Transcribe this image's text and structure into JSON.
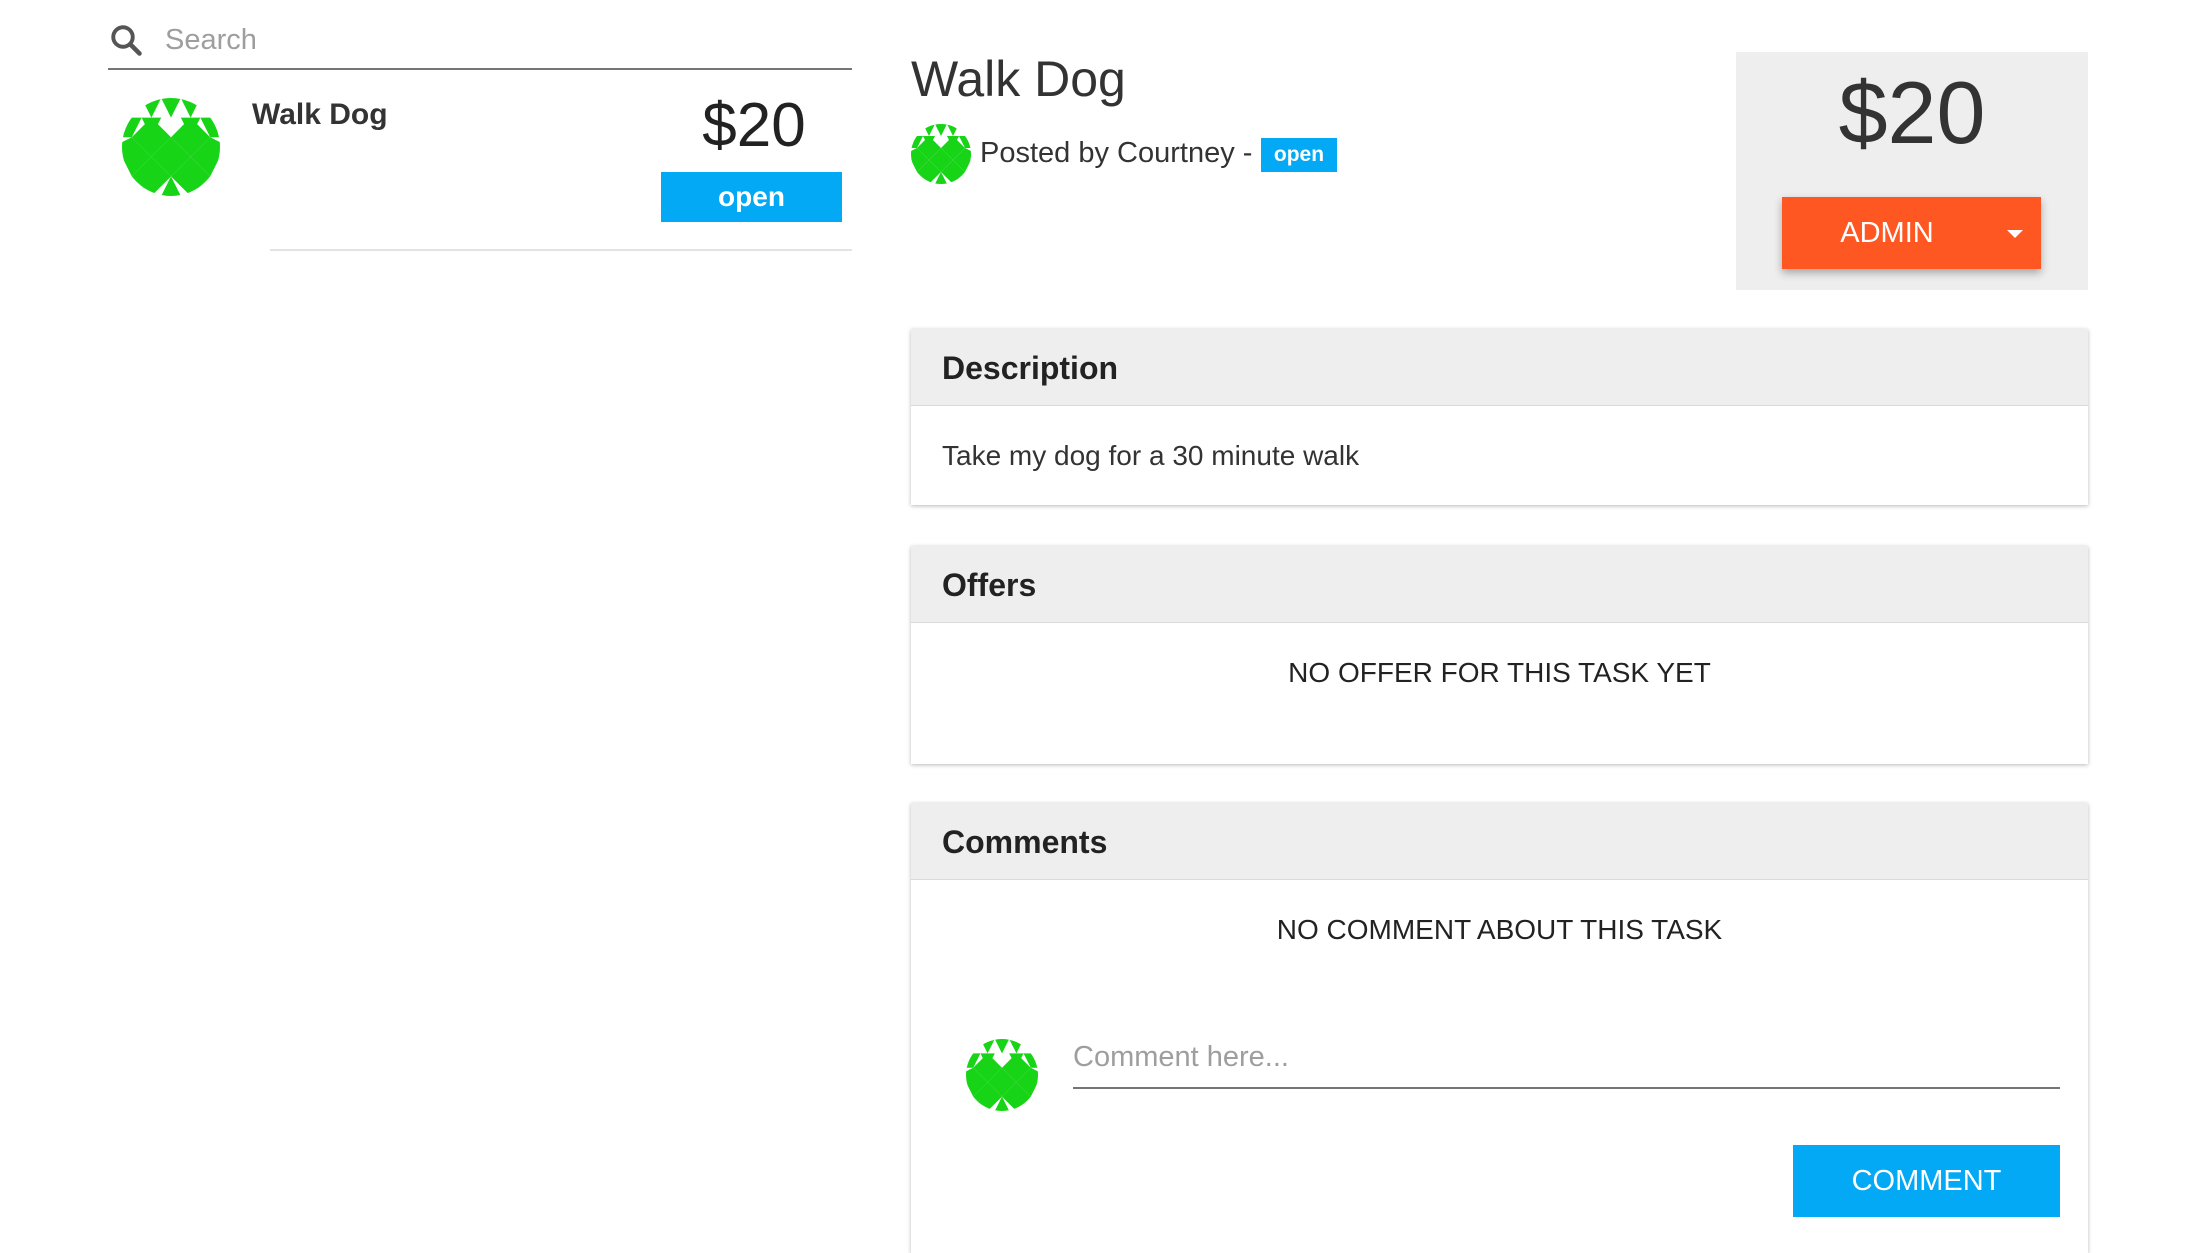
{
  "search": {
    "placeholder": "Search",
    "icon": "search-icon"
  },
  "task_list": [
    {
      "title": "Walk Dog",
      "price": "$20",
      "status": "open"
    }
  ],
  "detail": {
    "title": "Walk Dog",
    "posted_by": "Posted by Courtney -",
    "status": "open",
    "price": "$20",
    "admin_label": "ADMIN"
  },
  "description": {
    "header": "Description",
    "text": "Take my dog for a 30 minute walk"
  },
  "offers": {
    "header": "Offers",
    "empty": "NO OFFER FOR THIS TASK YET"
  },
  "comments": {
    "header": "Comments",
    "empty": "NO COMMENT ABOUT THIS TASK",
    "placeholder": "Comment here...",
    "button": "COMMENT"
  },
  "colors": {
    "accent_blue": "#03a9f4",
    "admin_orange": "#ff5722",
    "avatar_green": "#17d417",
    "panel_gray": "#eeeeee"
  }
}
